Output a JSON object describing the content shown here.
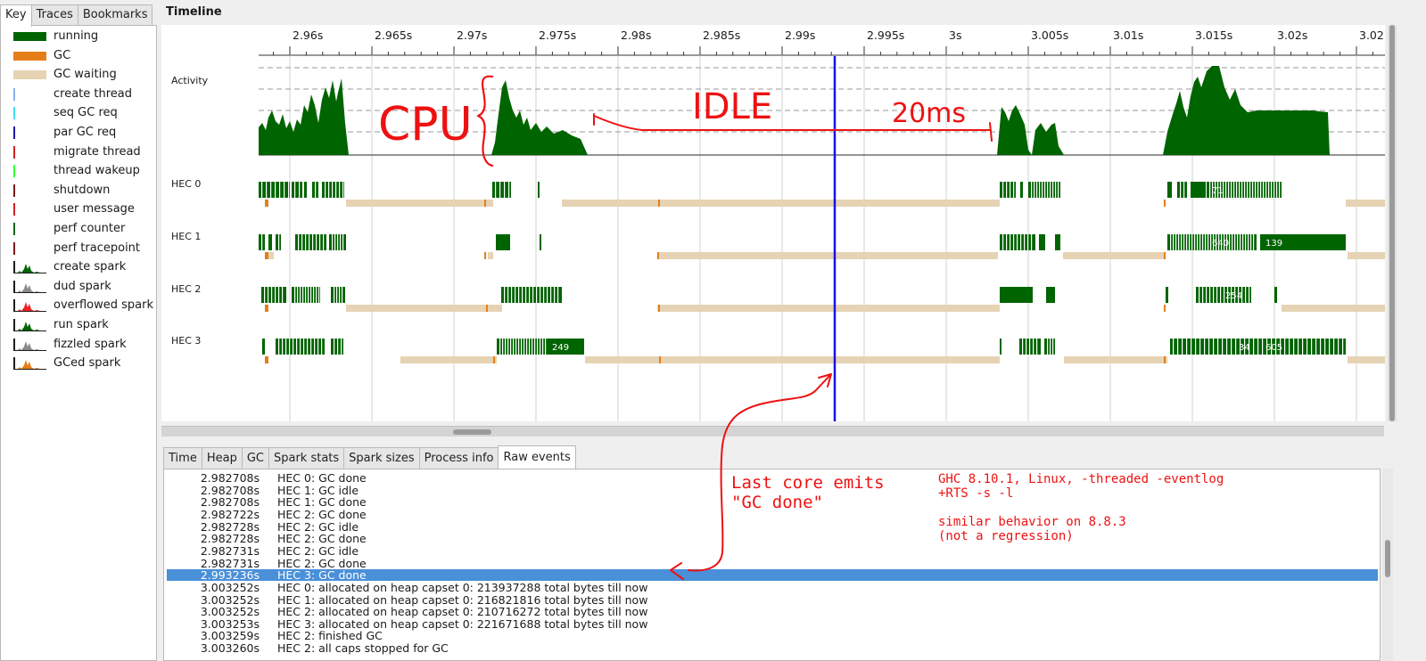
{
  "left_tabs": [
    {
      "label": "Key",
      "active": true
    },
    {
      "label": "Traces",
      "active": false
    },
    {
      "label": "Bookmarks",
      "active": false
    }
  ],
  "key_items": [
    {
      "label": "running",
      "swatch": "bar",
      "color": "#006400"
    },
    {
      "label": "GC",
      "swatch": "bar",
      "color": "#e57e19"
    },
    {
      "label": "GC waiting",
      "swatch": "bar",
      "color": "#e6d3b4"
    },
    {
      "label": "create thread",
      "swatch": "line",
      "color": "#8fb0ef"
    },
    {
      "label": "seq GC req",
      "swatch": "line",
      "color": "#44ddee"
    },
    {
      "label": "par GC req",
      "swatch": "line",
      "color": "#1a1aa8"
    },
    {
      "label": "migrate thread",
      "swatch": "line",
      "color": "#cc2222"
    },
    {
      "label": "thread wakeup",
      "swatch": "line",
      "color": "#33ff33"
    },
    {
      "label": "shutdown",
      "swatch": "line",
      "color": "#7a1a1a"
    },
    {
      "label": "user message",
      "swatch": "line",
      "color": "#cc2222"
    },
    {
      "label": "perf counter",
      "swatch": "line",
      "color": "#116611"
    },
    {
      "label": "perf tracepoint",
      "swatch": "line",
      "color": "#7a1a1a"
    },
    {
      "label": "create spark",
      "swatch": "spark",
      "color": "#006400"
    },
    {
      "label": "dud spark",
      "swatch": "spark",
      "color": "#8a8a8a"
    },
    {
      "label": "overflowed spark",
      "swatch": "spark",
      "color": "#ee2222"
    },
    {
      "label": "run spark",
      "swatch": "spark",
      "color": "#006400"
    },
    {
      "label": "fizzled spark",
      "swatch": "spark",
      "color": "#8a8a8a"
    },
    {
      "label": "GCed spark",
      "swatch": "spark",
      "color": "#e57e19"
    }
  ],
  "timeline": {
    "title": "Timeline",
    "ticks": [
      "2.96s",
      "2.965s",
      "2.97s",
      "2.975s",
      "2.98s",
      "2.985s",
      "2.99s",
      "2.995s",
      "3s",
      "3.005s",
      "3.01s",
      "3.015s",
      "3.02s",
      "3.02"
    ],
    "activity_label": "Activity",
    "hec_labels": [
      "HEC 0",
      "HEC 1",
      "HEC 2",
      "HEC 3"
    ],
    "bar_labels": {
      "hec0": [
        "71"
      ],
      "hec1": [
        "640",
        "139"
      ],
      "hec2": [
        "254"
      ],
      "hec3": [
        "249",
        "34",
        "605"
      ]
    },
    "colors": {
      "running": "#006400",
      "gc": "#e57e19",
      "gc_waiting": "#e6d3b4",
      "cursor": "#1414e6",
      "annotation": "#ee1111"
    }
  },
  "bottom_tabs": [
    {
      "label": "Time",
      "active": false
    },
    {
      "label": "Heap",
      "active": false
    },
    {
      "label": "GC",
      "active": false
    },
    {
      "label": "Spark stats",
      "active": false
    },
    {
      "label": "Spark sizes",
      "active": false
    },
    {
      "label": "Process info",
      "active": false
    },
    {
      "label": "Raw events",
      "active": true
    }
  ],
  "events": [
    {
      "time": "2.982708s",
      "desc": "HEC 0: GC done",
      "selected": false
    },
    {
      "time": "2.982708s",
      "desc": "HEC 1: GC idle",
      "selected": false
    },
    {
      "time": "2.982708s",
      "desc": "HEC 1: GC done",
      "selected": false
    },
    {
      "time": "2.982722s",
      "desc": "HEC 2: GC done",
      "selected": false
    },
    {
      "time": "2.982728s",
      "desc": "HEC 2: GC idle",
      "selected": false
    },
    {
      "time": "2.982728s",
      "desc": "HEC 2: GC done",
      "selected": false
    },
    {
      "time": "2.982731s",
      "desc": "HEC 2: GC idle",
      "selected": false
    },
    {
      "time": "2.982731s",
      "desc": "HEC 2: GC done",
      "selected": false
    },
    {
      "time": "2.993236s",
      "desc": "HEC 3: GC done",
      "selected": true
    },
    {
      "time": "3.003252s",
      "desc": "HEC 0: allocated on heap capset 0: 213937288 total bytes till now",
      "selected": false
    },
    {
      "time": "3.003252s",
      "desc": "HEC 1: allocated on heap capset 0: 216821816 total bytes till now",
      "selected": false
    },
    {
      "time": "3.003252s",
      "desc": "HEC 2: allocated on heap capset 0: 210716272 total bytes till now",
      "selected": false
    },
    {
      "time": "3.003253s",
      "desc": "HEC 3: allocated on heap capset 0: 221671688 total bytes till now",
      "selected": false
    },
    {
      "time": "3.003259s",
      "desc": "HEC 2: finished GC",
      "selected": false
    },
    {
      "time": "3.003260s",
      "desc": "HEC 2: all caps stopped for GC",
      "selected": false
    }
  ],
  "annotations": {
    "cpu": "CPU",
    "idle": "IDLE",
    "duration": "20ms",
    "last_core": "Last core emits\n\"GC done\"",
    "ghc_info": "GHC 8.10.1, Linux, -threaded -eventlog\n+RTS -s -l",
    "similar": "similar behavior on 8.8.3\n(not a regression)"
  }
}
